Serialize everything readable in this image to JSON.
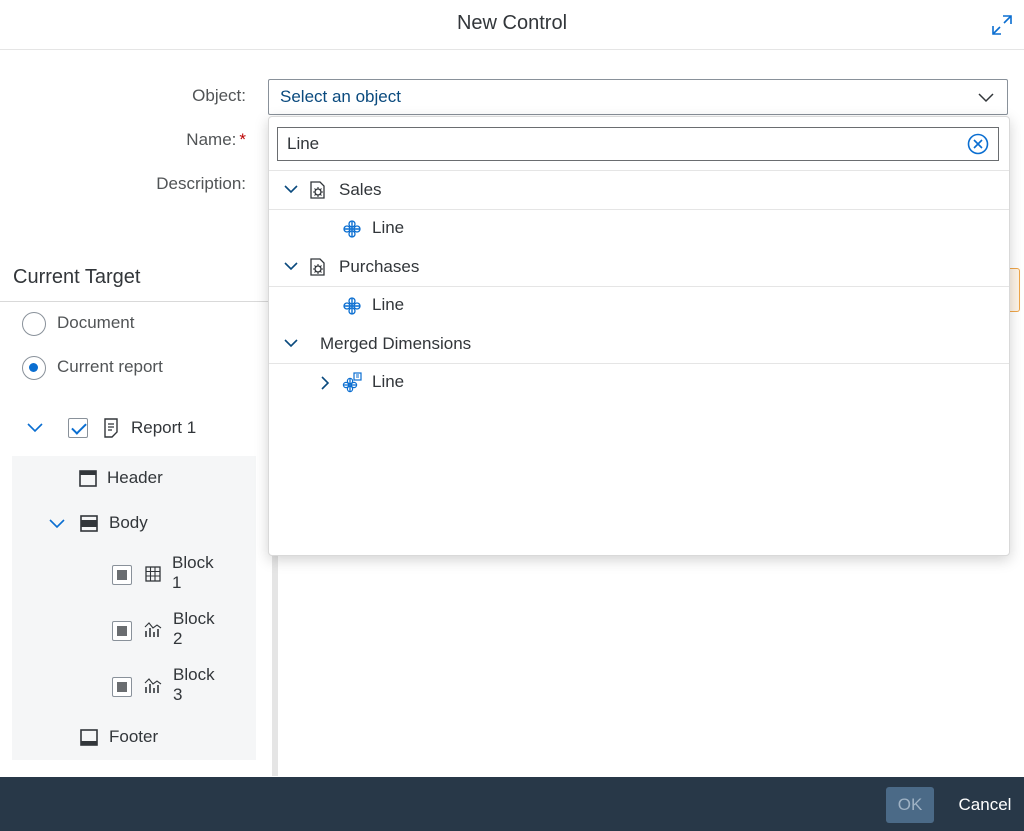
{
  "dialog": {
    "title": "New Control"
  },
  "form": {
    "object_label": "Object:",
    "object_placeholder": "Select an object",
    "name_label": "Name:",
    "required_mark": "*",
    "description_label": "Description:"
  },
  "target": {
    "section_title": "Current Target",
    "options": [
      {
        "label": "Document",
        "selected": false
      },
      {
        "label": "Current report",
        "selected": true
      }
    ],
    "tree": {
      "report": "Report 1",
      "header": "Header",
      "body": "Body",
      "blocks": [
        {
          "name": "Block",
          "number": "1",
          "icon": "table-icon"
        },
        {
          "name": "Block",
          "number": "2",
          "icon": "chart-icon"
        },
        {
          "name": "Block",
          "number": "3",
          "icon": "chart-icon"
        }
      ],
      "footer": "Footer"
    }
  },
  "dropdown": {
    "search_value": "Line",
    "groups": [
      {
        "label": "Sales",
        "icon": "datasource-icon",
        "children": [
          "Line"
        ]
      },
      {
        "label": "Purchases",
        "icon": "datasource-icon",
        "children": [
          "Line"
        ]
      },
      {
        "label": "Merged Dimensions",
        "icon": "",
        "children": [
          "Line"
        ]
      }
    ]
  },
  "buttons": {
    "ok": "OK",
    "cancel": "Cancel"
  },
  "colors": {
    "accent": "#0a6ed1",
    "footer_bg": "#283848",
    "link": "#0a4a7e",
    "required": "#bb0000"
  }
}
